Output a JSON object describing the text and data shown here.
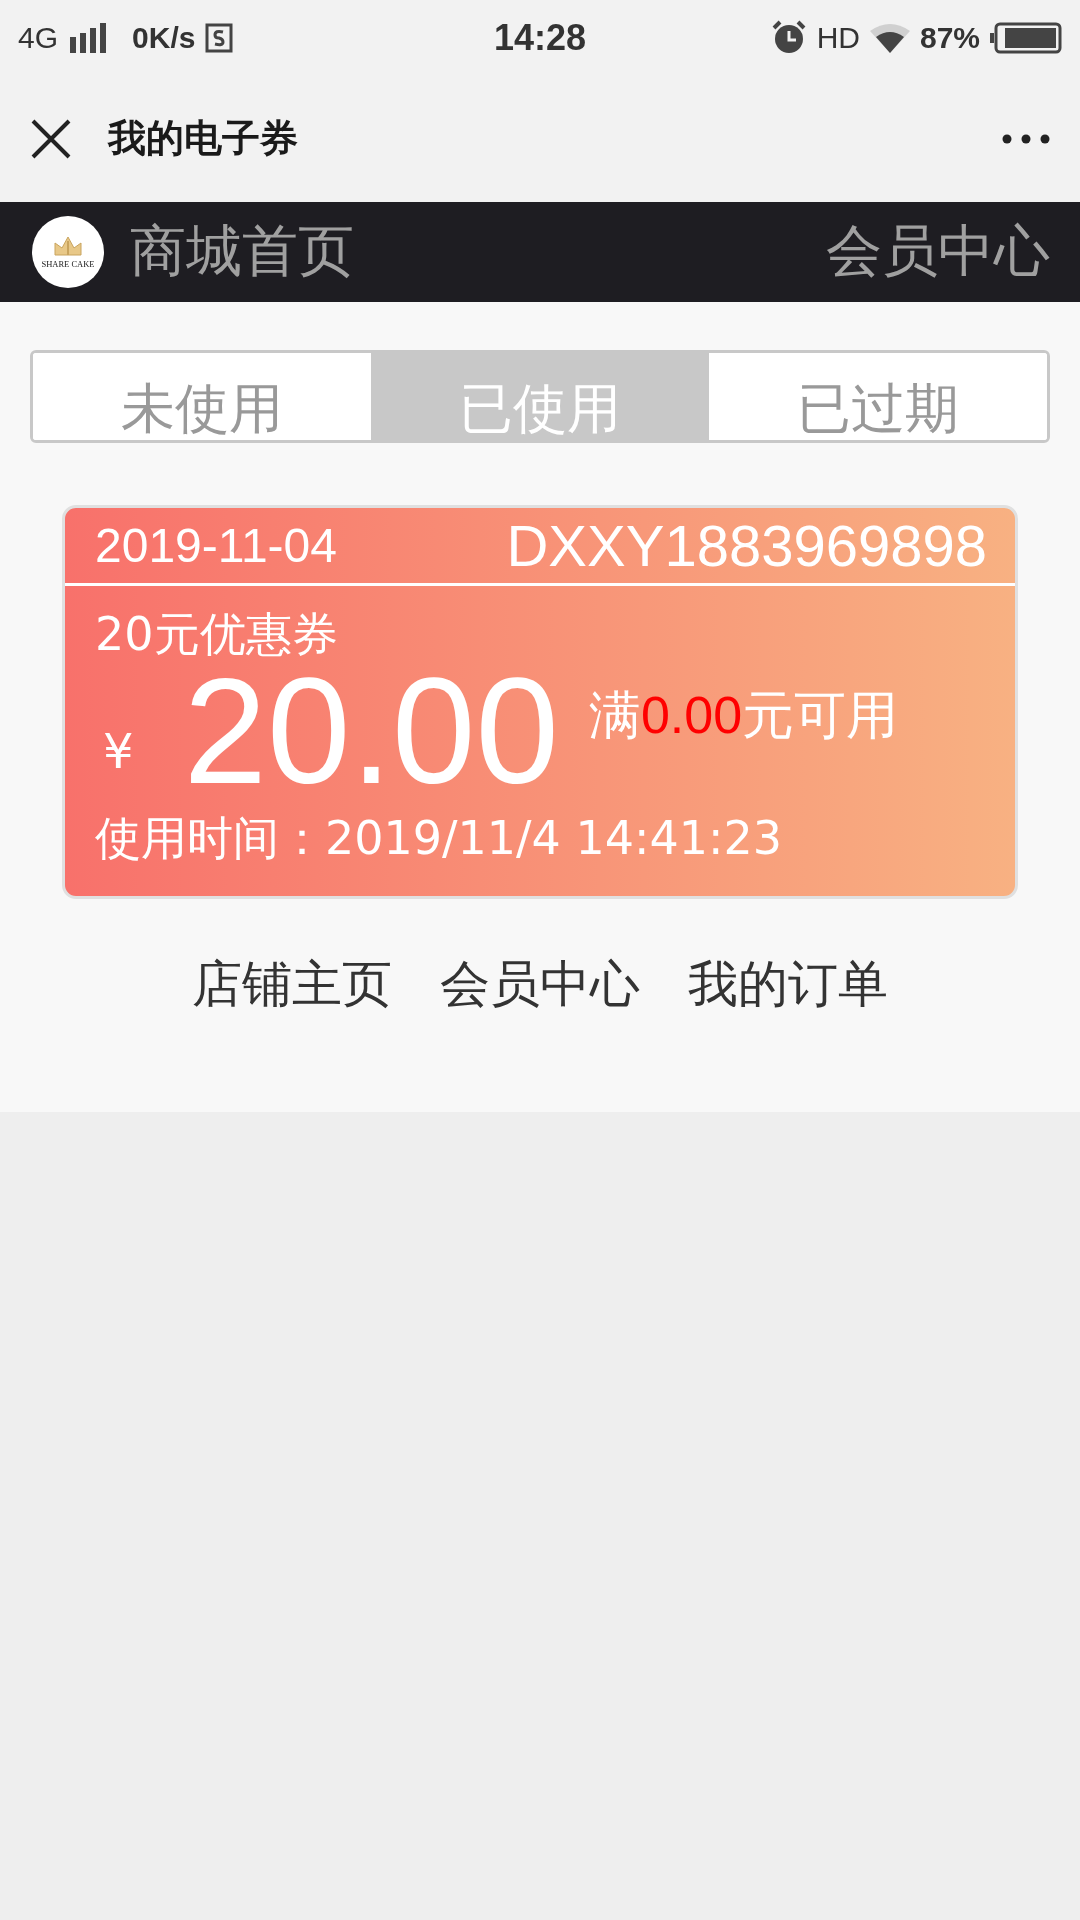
{
  "status_bar": {
    "network": "4G",
    "speed": "0K/s",
    "time": "14:28",
    "hd": "HD",
    "battery": "87%"
  },
  "nav_bar": {
    "title": "我的电子券"
  },
  "shop_header": {
    "logo_text": "SHARE CAKE",
    "home_link": "商城首页",
    "member_link": "会员中心"
  },
  "tabs": [
    {
      "label": "未使用",
      "selected": false
    },
    {
      "label": "已使用",
      "selected": true
    },
    {
      "label": "已过期",
      "selected": false
    }
  ],
  "coupons": [
    {
      "date": "2019-11-04",
      "code": "DXXY1883969898",
      "name": "20元优惠券",
      "currency": "¥",
      "amount": "20.00",
      "condition_prefix": "满",
      "condition_amount": "0.00",
      "condition_suffix": "元可用",
      "used_time": "使用时间：2019/11/4 14:41:23"
    }
  ],
  "footer_links": [
    "店铺主页",
    "会员中心",
    "我的订单"
  ]
}
